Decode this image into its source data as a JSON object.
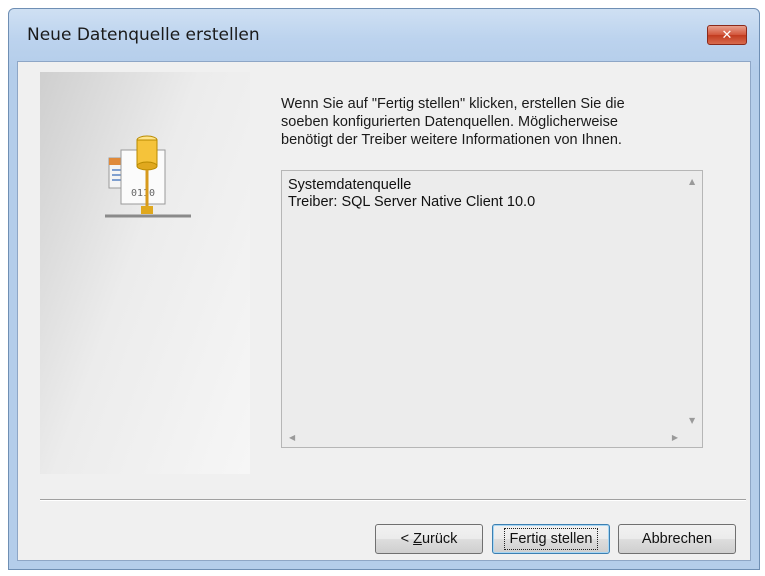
{
  "window": {
    "title": "Neue Datenquelle erstellen",
    "close_glyph": "✕"
  },
  "wizard": {
    "icon": "odbc-datasource-icon",
    "intro_text": "Wenn Sie auf \"Fertig stellen\" klicken, erstellen Sie die\nsoeben konfigurierten Datenquellen. Möglicherweise\nbenötigt der Treiber weitere Informationen von Ihnen.",
    "summary": {
      "text": "Systemdatenquelle\nTreiber:  SQL Server Native Client 10.0"
    }
  },
  "buttons": {
    "back_prefix": "< ",
    "back_mnemonic": "Z",
    "back_rest": "urück",
    "finish": "Fertig stellen",
    "cancel": "Abbrechen"
  },
  "colors": {
    "close_button": "#c23b1f",
    "title_bar": "#b4cdea",
    "dialog_bg": "#f0f0f0"
  }
}
